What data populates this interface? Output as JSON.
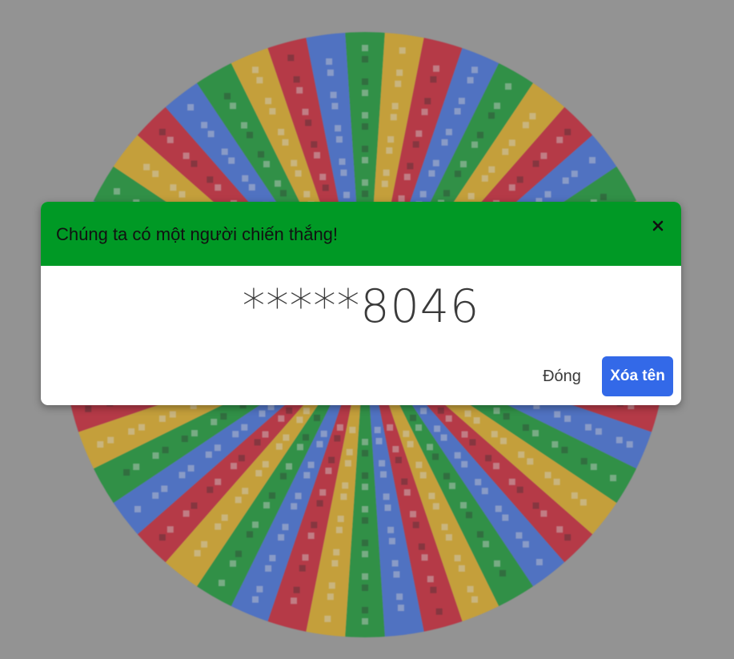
{
  "wheel": {
    "segment_colors": [
      "#009925",
      "#eeb211",
      "#d50f25",
      "#3369e8"
    ],
    "segment_count": 48,
    "background_color": "#9e9e9e"
  },
  "dialog": {
    "title": "Chúng ta có một người chiến thắng!",
    "header_color": "#009925",
    "close_icon": "close-icon",
    "winner_name": "*****8046",
    "close_label": "Đóng",
    "remove_label": "Xóa tên",
    "remove_color": "#3369e8"
  }
}
